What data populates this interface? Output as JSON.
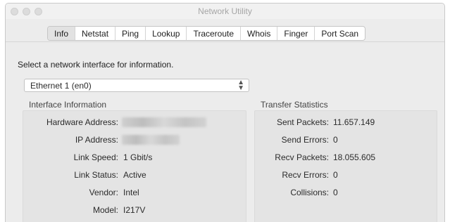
{
  "window": {
    "title": "Network Utility"
  },
  "tabs": [
    {
      "label": "Info",
      "active": true
    },
    {
      "label": "Netstat",
      "active": false
    },
    {
      "label": "Ping",
      "active": false
    },
    {
      "label": "Lookup",
      "active": false
    },
    {
      "label": "Traceroute",
      "active": false
    },
    {
      "label": "Whois",
      "active": false
    },
    {
      "label": "Finger",
      "active": false
    },
    {
      "label": "Port Scan",
      "active": false
    }
  ],
  "instruction": "Select a network interface for information.",
  "interface_select": {
    "value": "Ethernet 1 (en0)"
  },
  "interface_info": {
    "heading": "Interface Information",
    "hardware_address_label": "Hardware Address:",
    "ip_address_label": "IP Address:",
    "link_speed_label": "Link Speed:",
    "link_speed_value": "1 Gbit/s",
    "link_status_label": "Link Status:",
    "link_status_value": "Active",
    "vendor_label": "Vendor:",
    "vendor_value": "Intel",
    "model_label": "Model:",
    "model_value": "I217V"
  },
  "transfer_stats": {
    "heading": "Transfer Statistics",
    "sent_packets_label": "Sent Packets:",
    "sent_packets_value": "11.657.149",
    "send_errors_label": "Send Errors:",
    "send_errors_value": "0",
    "recv_packets_label": "Recv Packets:",
    "recv_packets_value": "18.055.605",
    "recv_errors_label": "Recv Errors:",
    "recv_errors_value": "0",
    "collisions_label": "Collisions:",
    "collisions_value": "0"
  }
}
